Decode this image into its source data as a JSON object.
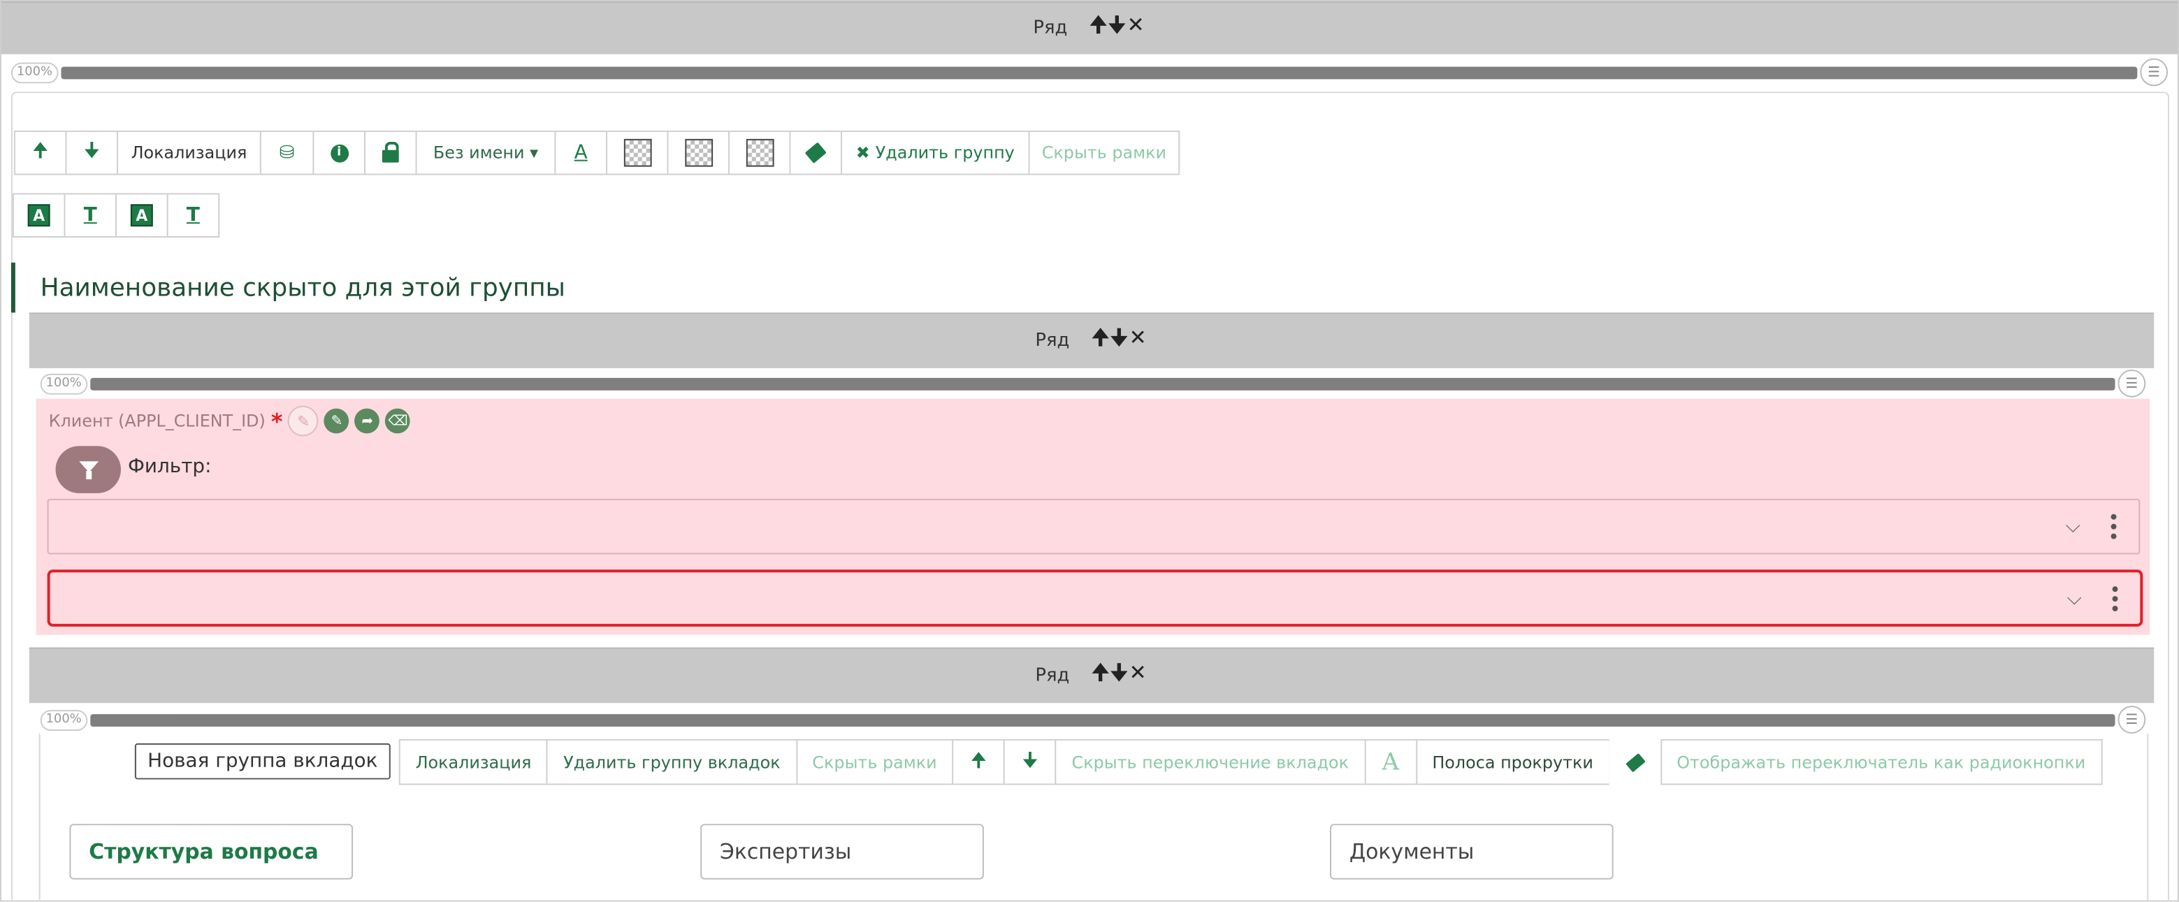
{
  "row_bar": {
    "label": "Ряд",
    "controls": "🠉🠋✕"
  },
  "slider": {
    "percent": "100%",
    "value": 1.0
  },
  "toolbar": {
    "localization": "Локализация",
    "no_name": "Без имени",
    "no_name_caret": "▾",
    "delete_group": "Удалить группу",
    "hide_frames": "Скрыть рамки",
    "delete_x": "✖"
  },
  "format_bar": {
    "a_label": "A",
    "t_label": "T"
  },
  "group_title": "Наименование скрыто для этой группы",
  "client_field": {
    "label": "Клиент (APPL_CLIENT_ID)",
    "required_mark": "*",
    "filter_label": "Фильтр:",
    "select1_value": "",
    "select2_value": ""
  },
  "tabs_toolbar": {
    "new_group_input": "Новая группа вкладок",
    "localization": "Локализация",
    "delete_tab_group": "Удалить группу вкладок",
    "hide_frames": "Скрыть рамки",
    "hide_tab_switch": "Скрыть переключение вкладок",
    "font_a": "A",
    "scrollbar": "Полоса прокрутки",
    "show_as_radio": "Отображать переключатель как радиокнопки"
  },
  "tabs": [
    {
      "label": "Структура вопроса",
      "active": true
    },
    {
      "label": "Экспертизы",
      "active": false
    },
    {
      "label": "Документы",
      "active": false
    }
  ],
  "colors": {
    "accent": "#1e7a46",
    "pink_bg": "#fedbe0",
    "error": "#e0202a"
  }
}
